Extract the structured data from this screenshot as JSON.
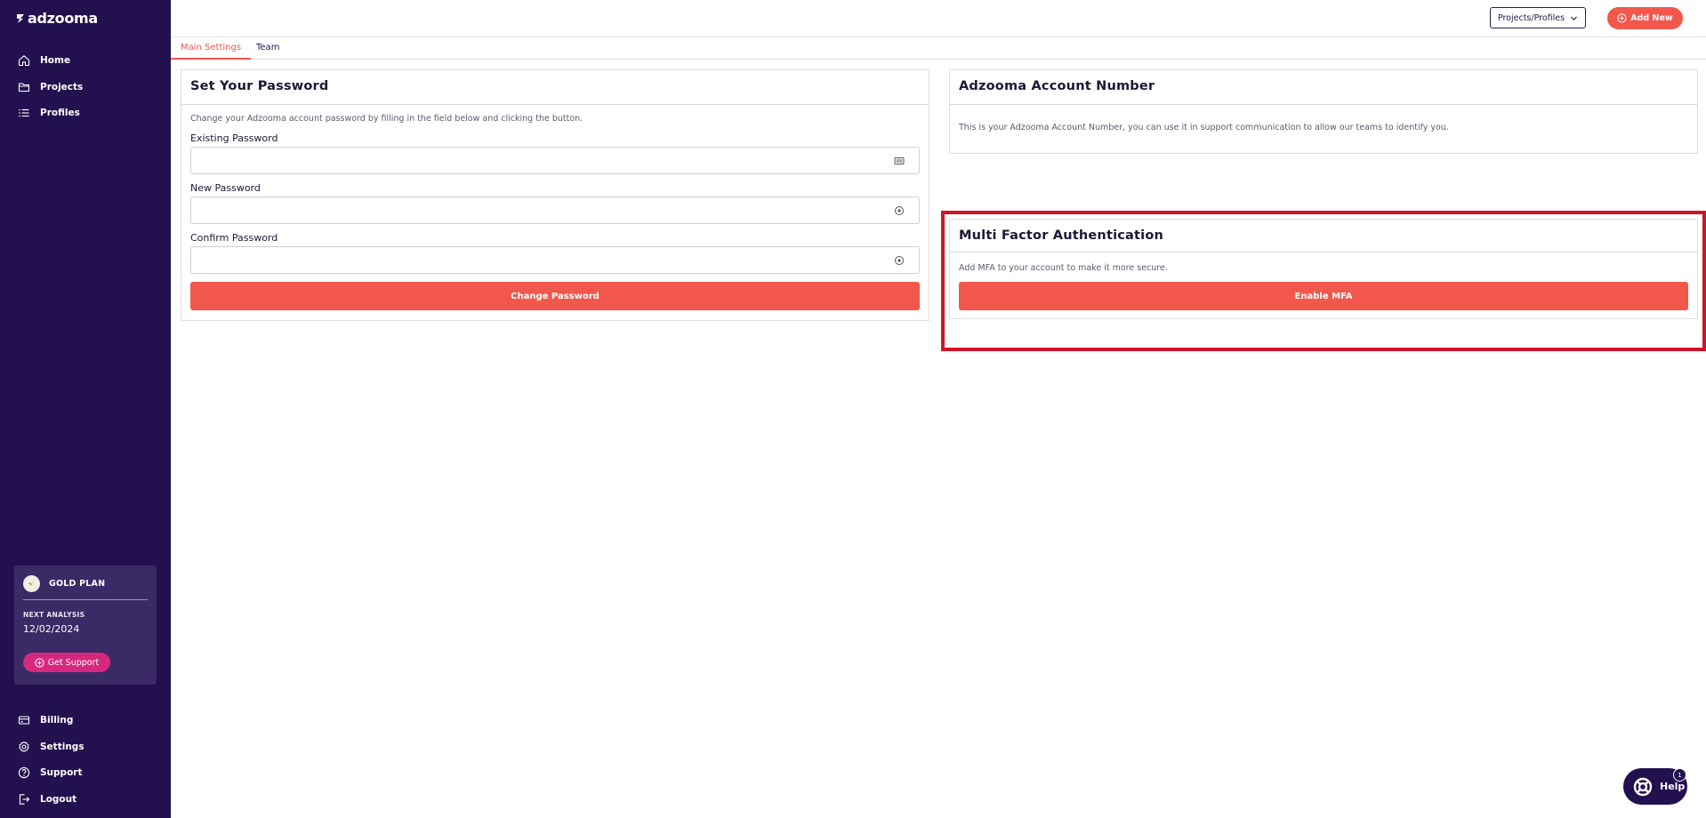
{
  "brand": {
    "name": "adzooma"
  },
  "sidebar": {
    "top_items": [
      {
        "label": "Home",
        "icon": "home-icon"
      },
      {
        "label": "Projects",
        "icon": "folder-icon"
      },
      {
        "label": "Profiles",
        "icon": "list-icon"
      }
    ],
    "bottom_items": [
      {
        "label": "Billing",
        "icon": "credit-card-icon"
      },
      {
        "label": "Settings",
        "icon": "gear-icon"
      },
      {
        "label": "Support",
        "icon": "question-circle-icon"
      },
      {
        "label": "Logout",
        "icon": "logout-icon"
      }
    ],
    "plan": {
      "name": "GOLD PLAN",
      "next_label": "NEXT ANALYSIS",
      "next_date": "12/02/2024",
      "support_label": "Get Support"
    }
  },
  "topbar": {
    "project_select": "Projects/Profiles",
    "add_new": "Add New"
  },
  "tabs": [
    "Main Settings",
    "Team"
  ],
  "password_card": {
    "title": "Set Your Password",
    "description": "Change your Adzooma account password by filling in the field below and clicking the button.",
    "fields": [
      {
        "label": "Existing Password",
        "value": ""
      },
      {
        "label": "New Password",
        "value": ""
      },
      {
        "label": "Confirm Password",
        "value": ""
      }
    ],
    "button": "Change Password"
  },
  "account_card": {
    "title": "Adzooma Account Number",
    "description": "This is your Adzooma Account Number, you can use it in support communication to allow our teams to identify you."
  },
  "mfa_card": {
    "title": "Multi Factor Authentication",
    "description": "Add MFA to your account to make it more secure.",
    "button": "Enable MFA"
  },
  "help": {
    "label": "Help",
    "count": "1"
  },
  "colors": {
    "sidebar_bg": "#23104f",
    "accent": "#f2574c",
    "support_pink": "#d6297d",
    "highlight_red": "#d1132a"
  }
}
